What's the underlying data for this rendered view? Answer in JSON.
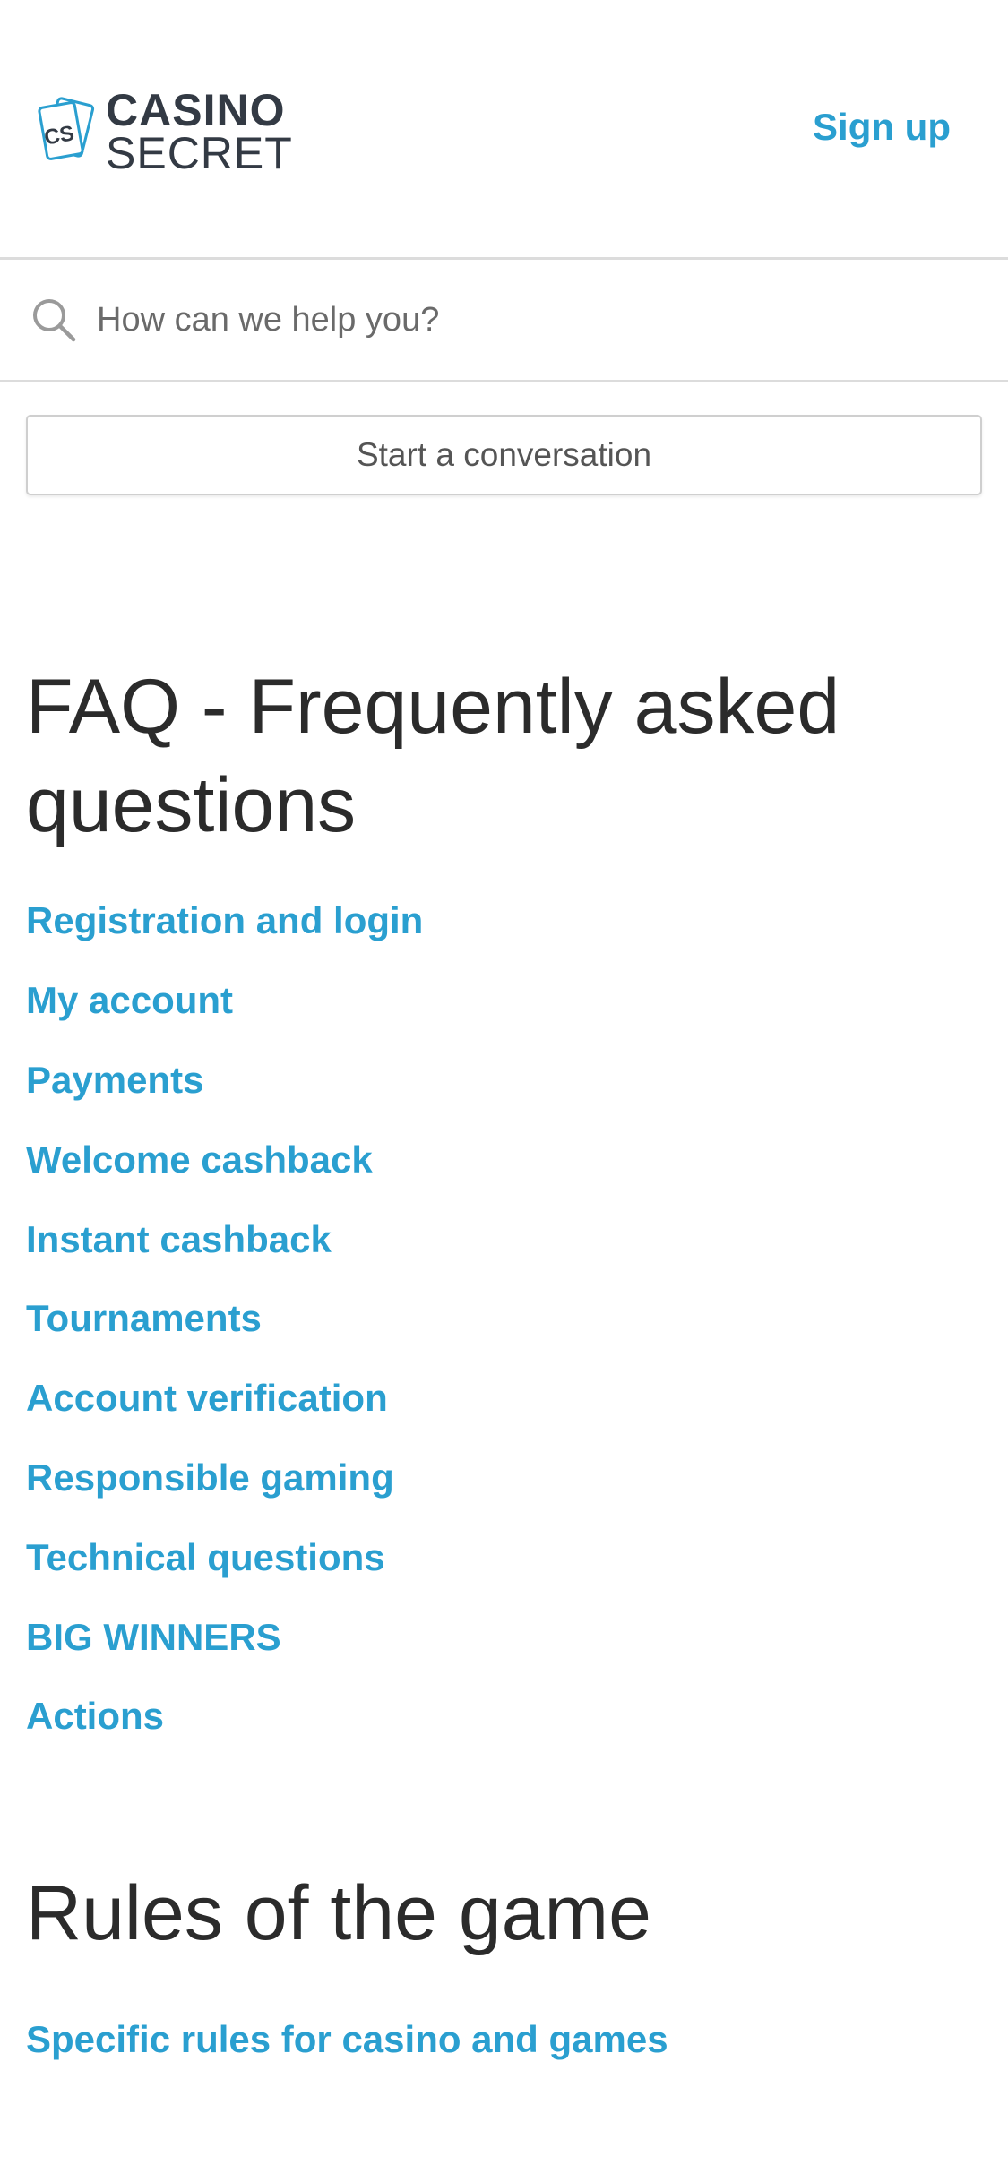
{
  "header": {
    "logo_line1": "CASINO",
    "logo_line2": "SECRET",
    "logo_badge": "CS",
    "signup_label": "Sign up"
  },
  "search": {
    "placeholder": "How can we help you?"
  },
  "conversation": {
    "button_label": "Start a conversation"
  },
  "faq": {
    "title": "FAQ - Frequently asked questions",
    "categories": [
      "Registration and login",
      "My account",
      "Payments",
      "Welcome cashback",
      "Instant cashback",
      "Tournaments",
      "Account verification",
      "Responsible gaming",
      "Technical questions",
      "BIG WINNERS",
      "Actions"
    ]
  },
  "rules": {
    "title": "Rules of the game",
    "categories": [
      "Specific rules for casino and games"
    ]
  },
  "colors": {
    "accent": "#2a9fd0",
    "text": "#2b2b2b",
    "divider": "#dcdcdc",
    "logo": "#333a44"
  }
}
